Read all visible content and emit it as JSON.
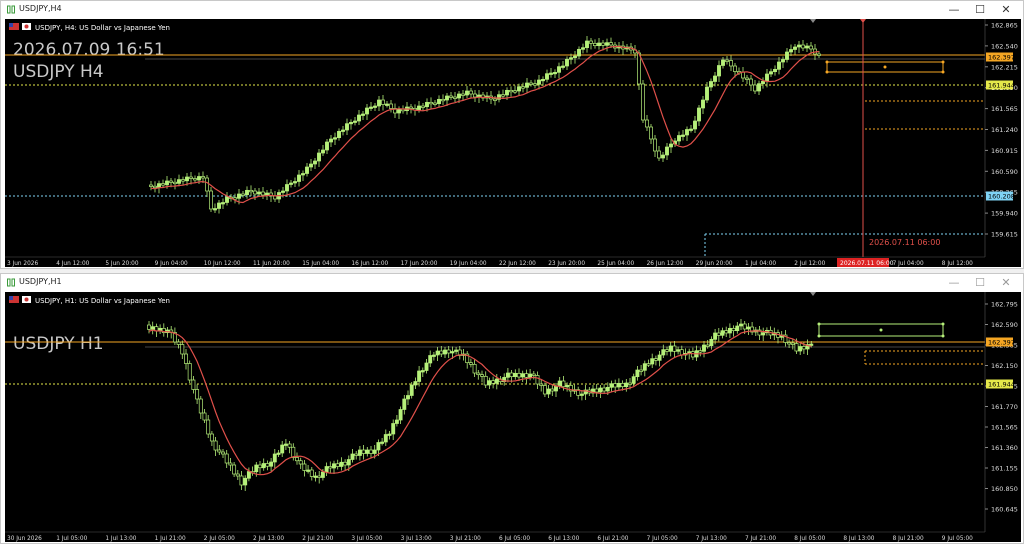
{
  "windows": [
    {
      "title": "USDJPY,H4",
      "info": "USDJPY, H4: US Dollar vs Japanese Yen",
      "overlay_time": "2026.07.09 16:51",
      "overlay_symbol": "USDJPY H4",
      "price_labels": [
        "162.865",
        "162.540",
        "162.215",
        "161.890",
        "161.565",
        "161.240",
        "160.915",
        "160.590",
        "160.265",
        "159.940",
        "159.615"
      ],
      "time_labels": [
        "3 Jun 2026",
        "4 Jun 12:00",
        "5 Jun 20:00",
        "9 Jun 04:00",
        "10 Jun 12:00",
        "11 Jun 20:00",
        "15 Jun 04:00",
        "16 Jun 12:00",
        "17 Jun 20:00",
        "19 Jun 04:00",
        "22 Jun 12:00",
        "23 Jun 20:00",
        "25 Jun 04:00",
        "26 Jun 12:00",
        "29 Jun 20:00",
        "1 Jul 04:00",
        "2 Jul 12:00",
        "3 Jul 20:00",
        "7 Jul 04:00",
        "8 Jul 12:00"
      ],
      "badges": [
        {
          "text": "162.397",
          "color": "#f5a623"
        },
        {
          "text": "161.944",
          "color": "#e5e84a"
        },
        {
          "text": "160.208",
          "color": "#7fd3f5"
        }
      ],
      "vline_label": "2026.07.11 06:00",
      "vline_axis_label": "2026.07.11 06:00"
    },
    {
      "title": "USDJPY,H1",
      "info": "USDJPY, H1: US Dollar vs Japanese Yen",
      "overlay_symbol": "USDJPY H1",
      "price_labels": [
        "162.795",
        "162.590",
        "162.385",
        "162.150",
        "161.975",
        "161.770",
        "161.565",
        "161.360",
        "161.155",
        "160.850",
        "160.645"
      ],
      "time_labels": [
        "30 Jun 2026",
        "1 Jul 05:00",
        "1 Jul 13:00",
        "1 Jul 21:00",
        "2 Jul 05:00",
        "2 Jul 13:00",
        "2 Jul 21:00",
        "3 Jul 05:00",
        "3 Jul 13:00",
        "3 Jul 21:00",
        "6 Jul 05:00",
        "6 Jul 13:00",
        "6 Jul 21:00",
        "7 Jul 05:00",
        "7 Jul 13:00",
        "7 Jul 21:00",
        "8 Jul 05:00",
        "8 Jul 13:00",
        "8 Jul 21:00",
        "9 Jul 05:00"
      ],
      "badges": [
        {
          "text": "162.397",
          "color": "#f5a623"
        },
        {
          "text": "161.944",
          "color": "#e5e84a"
        }
      ]
    }
  ],
  "window_buttons": {
    "minimize": "—",
    "maximize": "☐",
    "close": "✕"
  },
  "colors": {
    "bull": "#b6f07a",
    "ma": "#e0504a",
    "orange_line": "#f5a623",
    "yellow_line": "#e5e84a",
    "cyan_line": "#7fd3f5",
    "red_line": "#e0504a"
  }
}
